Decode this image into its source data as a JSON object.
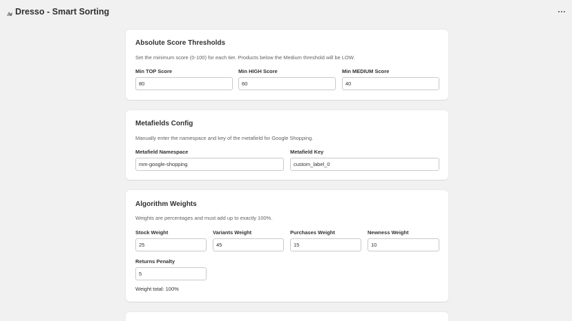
{
  "header": {
    "title": "Dresso - Smart Sorting"
  },
  "thresholds": {
    "title": "Absolute Score Thresholds",
    "description": "Set the minimum score (0-100) for each tier. Products below the Medium threshold will be LOW.",
    "fields": [
      {
        "label": "Min TOP Score",
        "value": "80"
      },
      {
        "label": "Min HIGH Score",
        "value": "60"
      },
      {
        "label": "Min MEDIUM Score",
        "value": "40"
      }
    ]
  },
  "metafields": {
    "title": "Metafields Config",
    "description": "Manually enter the namespace and key of the metafield for Google Shopping.",
    "fields": [
      {
        "label": "Metafield Namespace",
        "value": "mm-google-shopping"
      },
      {
        "label": "Metafield Key",
        "value": "custom_label_0"
      }
    ]
  },
  "weights": {
    "title": "Algorithm Weights",
    "description": "Weights are percentages and must add up to exactly 100%.",
    "fields": [
      {
        "label": "Stock Weight",
        "value": "25"
      },
      {
        "label": "Variants Weight",
        "value": "45"
      },
      {
        "label": "Purchases Weight",
        "value": "15"
      },
      {
        "label": "Newness Weight",
        "value": "10"
      },
      {
        "label": "Returns Penalty",
        "value": "5"
      }
    ],
    "total_text": "Weight total: 100%"
  }
}
